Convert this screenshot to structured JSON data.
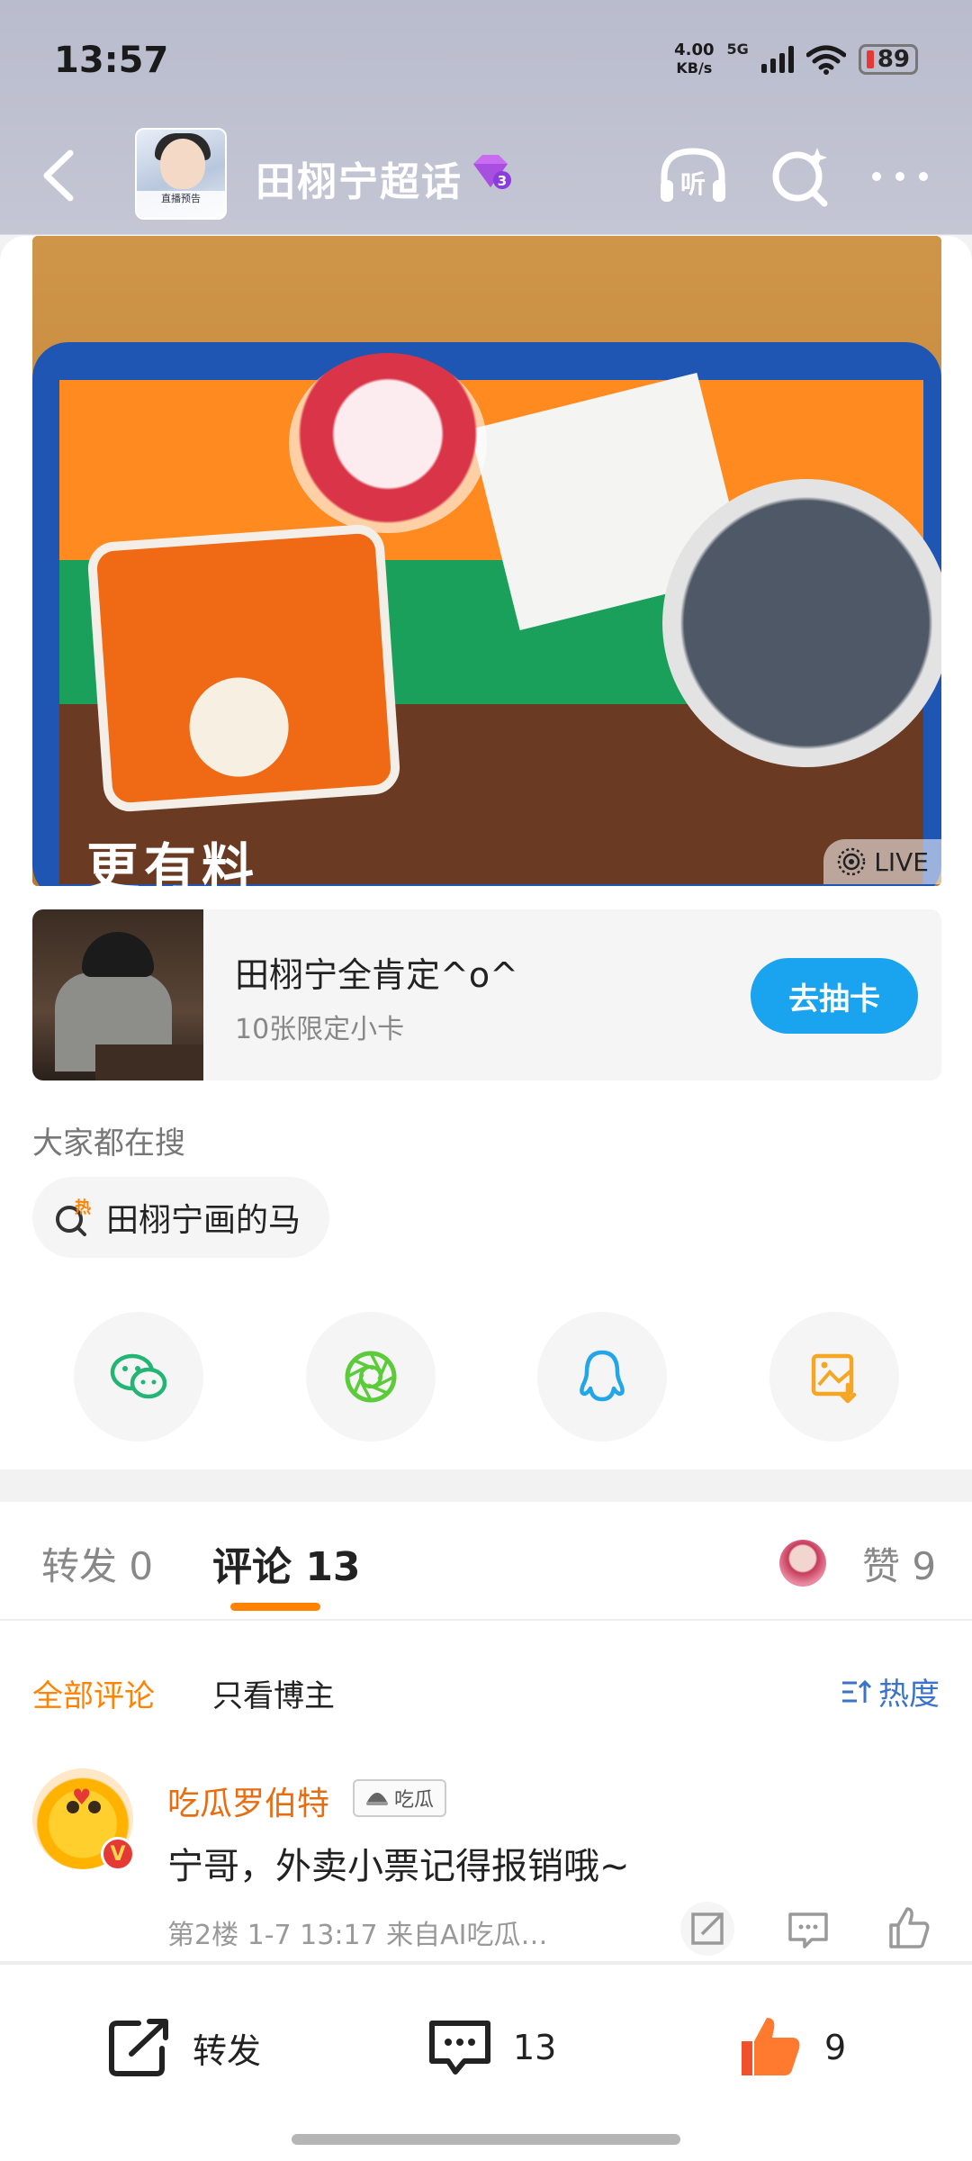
{
  "status_bar": {
    "time": "13:57",
    "net_speed_value": "4.00",
    "net_speed_unit": "KB/s",
    "signal_type": "5G",
    "battery": "89"
  },
  "header": {
    "title": "田栩宁超话",
    "level_badge": "3",
    "avatar_caption": "直播预告",
    "listen_icon_label": "听"
  },
  "post": {
    "live_label": "LIVE",
    "photo_slogan": "更有料"
  },
  "promo": {
    "title": "田栩宁全肯定^o^",
    "subtitle": "10张限定小卡",
    "button_label": "去抽卡"
  },
  "trending": {
    "label": "大家都在搜",
    "hot_badge": "热",
    "query": "田栩宁画的马"
  },
  "share": {
    "icons": [
      "wechat-icon",
      "moments-icon",
      "qq-icon",
      "save-image-icon"
    ]
  },
  "tabs": {
    "repost": "转发 0",
    "comment": "评论 13",
    "like": "赞 9"
  },
  "comment_filters": {
    "all": "全部评论",
    "owner_only": "只看博主",
    "sort": "热度"
  },
  "comments": [
    {
      "user": "吃瓜罗伯特",
      "tag": "吃瓜",
      "text": "宁哥，外卖小票记得报销哦~",
      "meta": "第2楼  1-7 13:17  来自AI吃瓜…"
    }
  ],
  "bottom_bar": {
    "repost_label": "转发",
    "comment_count": "13",
    "like_count": "9"
  },
  "colors": {
    "accent_orange": "#ff8200",
    "promo_button": "#1aa3ee",
    "like_red": "#f0502a"
  }
}
